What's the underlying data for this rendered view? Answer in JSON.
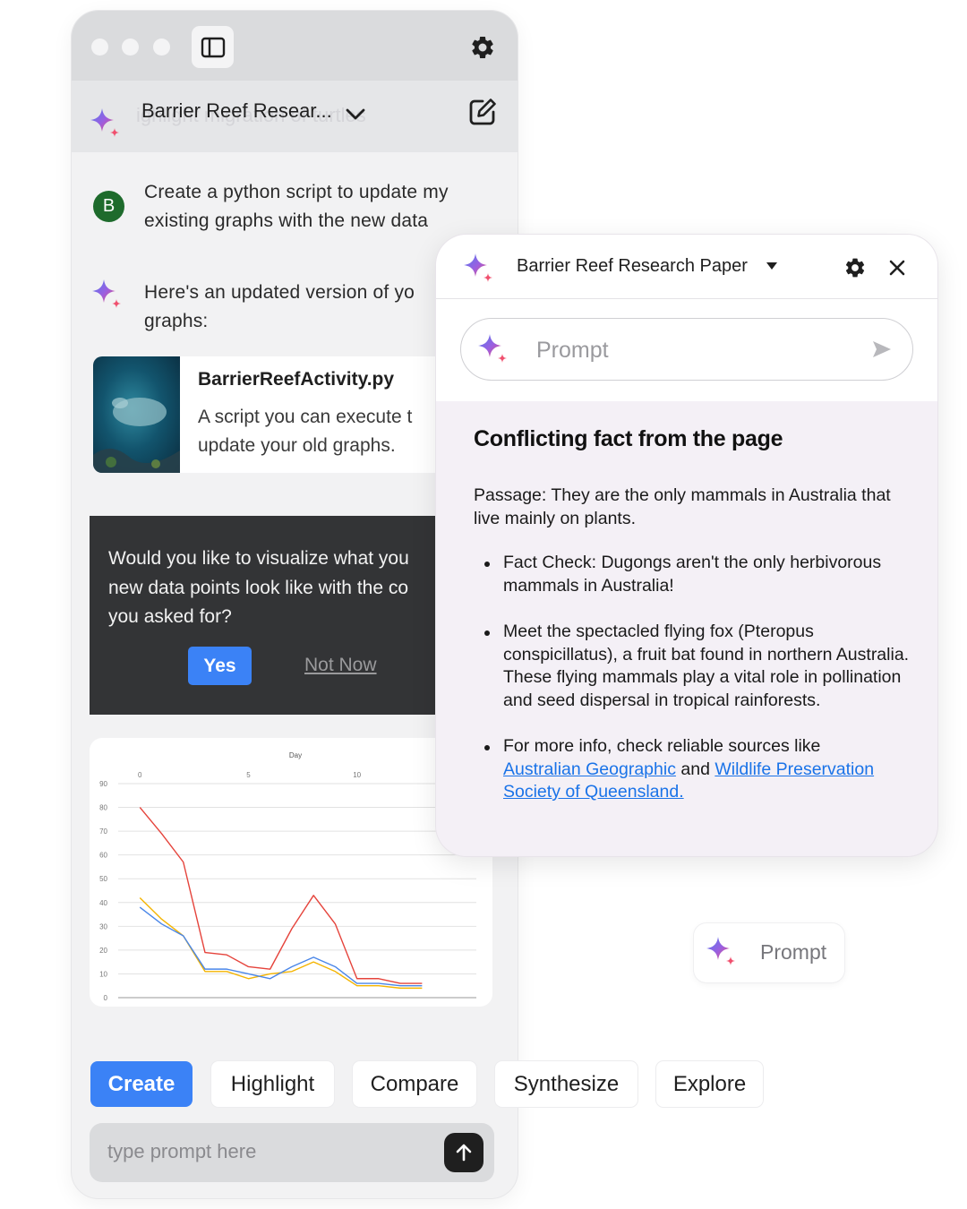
{
  "app": {
    "chat_title": "Barrier Reef Resear...",
    "ghost_text": "ighlight migration of turtles",
    "messages": {
      "user_avatar": "B",
      "user_line1": "Create a python script to update my",
      "user_line2": "existing graphs with the new data",
      "ai_line1": "Here's an updated version of yo",
      "ai_line2": "graphs:"
    },
    "file": {
      "name": "BarrierReefActivity.py",
      "desc_line1": "A script you can execute t",
      "desc_line2": "update your old graphs."
    },
    "suggestion": {
      "line1": "Would you like to visualize what you",
      "line2": "new data points look like with the co",
      "line3": "you asked for?",
      "yes": "Yes",
      "not_now": "Not Now"
    },
    "actions": [
      "Create",
      "Highlight",
      "Compare",
      "Synthesize",
      "Explore"
    ],
    "input_placeholder": "type prompt here"
  },
  "chart_data": {
    "type": "line",
    "xlabel": "Day",
    "ylabel": "",
    "x_ticks": [
      0,
      5,
      10
    ],
    "y_ticks": [
      0,
      10,
      20,
      30,
      40,
      50,
      60,
      70,
      80,
      90
    ],
    "xlim": [
      -1,
      15.5
    ],
    "ylim": [
      0,
      90
    ],
    "x": [
      0,
      1,
      2,
      3,
      4,
      5,
      6,
      7,
      8,
      9,
      10,
      11,
      12,
      13
    ],
    "series": [
      {
        "color": "#e5433b",
        "values": [
          80,
          69,
          57,
          19,
          18,
          13,
          12,
          29,
          43,
          31,
          8,
          8,
          6,
          6
        ]
      },
      {
        "color": "#f4b400",
        "values": [
          42,
          33,
          26,
          11,
          11,
          8,
          10,
          11,
          15,
          11,
          5,
          5,
          4,
          4
        ]
      },
      {
        "color": "#4a86e8",
        "values": [
          38,
          31,
          26,
          12,
          12,
          10,
          8,
          13,
          17,
          13,
          6,
          6,
          5,
          5
        ]
      }
    ]
  },
  "panel": {
    "title": "Barrier Reef Research Paper",
    "prompt_placeholder": "Prompt",
    "heading": "Conflicting fact from the page",
    "passage": "Passage: They are the only mammals in Australia that live mainly on plants.",
    "bullet1": "Fact Check: Dugongs aren't the only herbivorous mammals in Australia!",
    "bullet2": "Meet the spectacled flying fox (Pteropus conspicillatus), a fruit bat found in northern Australia. These flying mammals play a vital role in pollination and seed dispersal in tropical rainforests.",
    "bullet3_prefix": "For more info, check reliable sources like",
    "link1": "Australian Geographic",
    "and": "and",
    "link2": "Wildlife Preservation Society of Queensland."
  },
  "chip": {
    "label": "Prompt"
  },
  "colors": {
    "accent": "#3b82f6",
    "dark_card": "#333436",
    "panel_bg": "#f4f0f6"
  }
}
